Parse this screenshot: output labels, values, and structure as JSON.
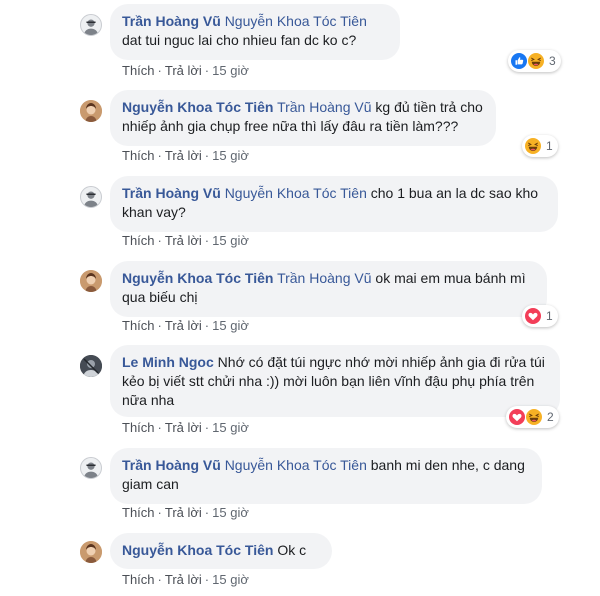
{
  "comments": [
    {
      "author": "Trần Hoàng Vũ",
      "tag": "Nguyễn Khoa Tóc Tiên",
      "text": " dat tui nguc lai cho nhieu fan dc ko c?",
      "like": "Thích",
      "reply": "Trả lời",
      "time": "15 giờ",
      "reaction_count": "3"
    },
    {
      "author": "Nguyễn Khoa Tóc Tiên",
      "tag": "Trần Hoàng Vũ",
      "text": " kg đủ tiền trả cho nhiếp ảnh gia chụp free nữa thì lấy đâu ra tiền làm???",
      "like": "Thích",
      "reply": "Trả lời",
      "time": "15 giờ",
      "reaction_count": "1"
    },
    {
      "author": "Trần Hoàng Vũ",
      "tag": "Nguyễn Khoa Tóc Tiên",
      "text": " cho 1 bua an la dc sao kho khan vay?",
      "like": "Thích",
      "reply": "Trả lời",
      "time": "15 giờ",
      "reaction_count": ""
    },
    {
      "author": "Nguyễn Khoa Tóc Tiên",
      "tag": "Trần Hoàng Vũ",
      "text": " ok mai em mua bánh mì qua biếu chị",
      "like": "Thích",
      "reply": "Trả lời",
      "time": "15 giờ",
      "reaction_count": "1"
    },
    {
      "author": "Le Minh Ngoc",
      "tag": "",
      "text": " Nhớ có đặt túi ngực nhớ mời nhiếp ảnh gia đi rửa túi kẻo bị viết stt chửi nha :)) mời luôn bạn liên vĩnh đậu phụ phía trên nữa nha",
      "like": "Thích",
      "reply": "Trả lời",
      "time": "15 giờ",
      "reaction_count": "2"
    },
    {
      "author": "Trần Hoàng Vũ",
      "tag": "Nguyễn Khoa Tóc Tiên",
      "text": " banh mi den nhe, c dang giam can",
      "like": "Thích",
      "reply": "Trả lời",
      "time": "15 giờ",
      "reaction_count": ""
    },
    {
      "author": "Nguyễn Khoa Tóc Tiên",
      "tag": "",
      "text": " Ok c",
      "like": "Thích",
      "reply": "Trả lời",
      "time": "15 giờ",
      "reaction_count": ""
    }
  ],
  "reactions": {
    "c1": [
      "like-icon",
      "haha-icon"
    ],
    "c2": [
      "haha-icon"
    ],
    "c4": [
      "love-icon"
    ],
    "c5": [
      "love-icon",
      "haha-icon"
    ]
  },
  "colors": {
    "name": "#385898",
    "bubble": "#f2f3f5",
    "like": "#1877f2",
    "love": "#f33e58",
    "haha": "#f7b125"
  }
}
